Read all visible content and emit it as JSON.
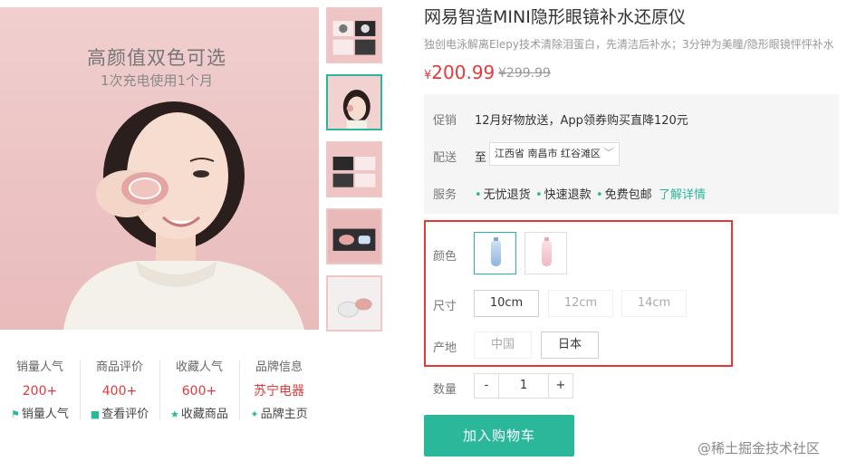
{
  "hero": {
    "headline": "高颜值双色可选",
    "subline": "1次充电使用1个月"
  },
  "thumbnails": [
    "thumb-1",
    "thumb-2",
    "thumb-3",
    "thumb-4",
    "thumb-5"
  ],
  "stats": [
    {
      "title": "销量人气",
      "value": "200+",
      "action": "销量人气",
      "icon": "flag-icon"
    },
    {
      "title": "商品评价",
      "value": "400+",
      "action": "查看评价",
      "icon": "comment-icon"
    },
    {
      "title": "收藏人气",
      "value": "600+",
      "action": "收藏商品",
      "icon": "star-icon"
    },
    {
      "title": "品牌信息",
      "value": "苏宁电器",
      "action": "品牌主页",
      "icon": "brand-icon"
    }
  ],
  "product": {
    "title": "网易智造MINI隐形眼镜补水还原仪",
    "subtitle": "独创电泳解离Elepy技术清除泪蛋白，先清洁后补水；3分钟为美瞳/隐形眼镜怦怦补水",
    "price_symbol": "¥",
    "price": "200.99",
    "original_price": "¥299.99"
  },
  "promo": {
    "promo_label": "促销",
    "promo_text": "12月好物放送，App领券购买直降120元",
    "delivery_label": "配送",
    "delivery_to": "至",
    "address": "江西省 南昌市 红谷滩区",
    "service_label": "服务",
    "services": [
      "无忧退货",
      "快速退款",
      "免费包邮"
    ],
    "more_link": "了解详情"
  },
  "specs": {
    "color_label": "颜色",
    "size_label": "尺寸",
    "sizes": [
      "10cm",
      "12cm",
      "14cm"
    ],
    "origin_label": "产地",
    "origins": [
      "中国",
      "日本"
    ]
  },
  "quantity": {
    "label": "数量",
    "minus": "-",
    "value": "1",
    "plus": "+"
  },
  "cart_button": "加入购物车",
  "watermark": "@稀土掘金技术社区",
  "colors": {
    "accent": "#2bb89a",
    "price": "#e4393c",
    "highlight_border": "#e53935"
  }
}
